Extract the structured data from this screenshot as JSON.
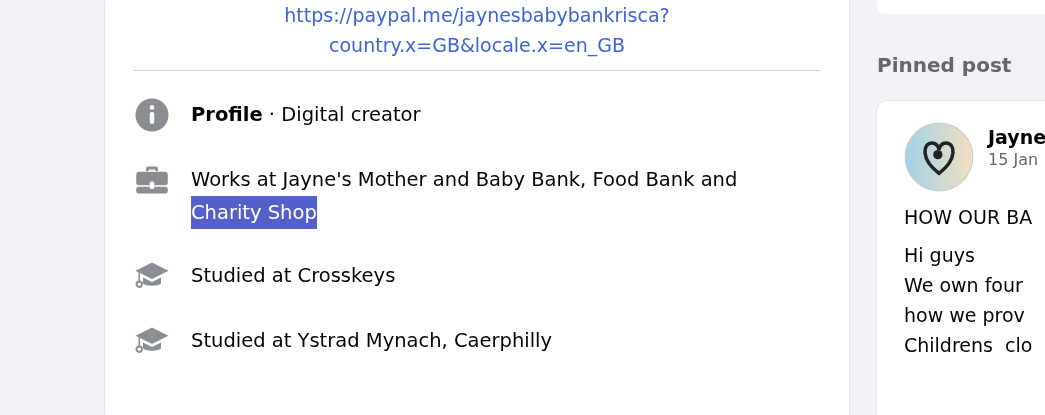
{
  "intro": {
    "link_lines": [
      "https://paypal.me/jaynesbabybankrisca?",
      "country.x=GB&locale.x=en_GB"
    ]
  },
  "details": [
    {
      "kind": "info",
      "segments": [
        {
          "text": "**Profile** · Digital creator",
          "selected": false
        }
      ]
    },
    {
      "kind": "work",
      "segments": [
        {
          "text": "Works at Jayne's Mother and Baby Bank, Food Bank and",
          "selected": false
        },
        {
          "text": "Charity Shop",
          "selected": true
        }
      ]
    },
    {
      "kind": "education",
      "segments": [
        {
          "text": "Studied at Crosskeys",
          "selected": false
        }
      ]
    },
    {
      "kind": "education",
      "segments": [
        {
          "text": "Studied at Ystrad Mynach, Caerphilly",
          "selected": false
        }
      ]
    }
  ],
  "pinned": {
    "heading": "Pinned post",
    "author": "Jayne",
    "date": "15 Jan",
    "title": "HOW OUR BA",
    "body_lines": [
      "Hi guys",
      "We own four",
      "how we prov",
      "Childrens  clo"
    ]
  }
}
